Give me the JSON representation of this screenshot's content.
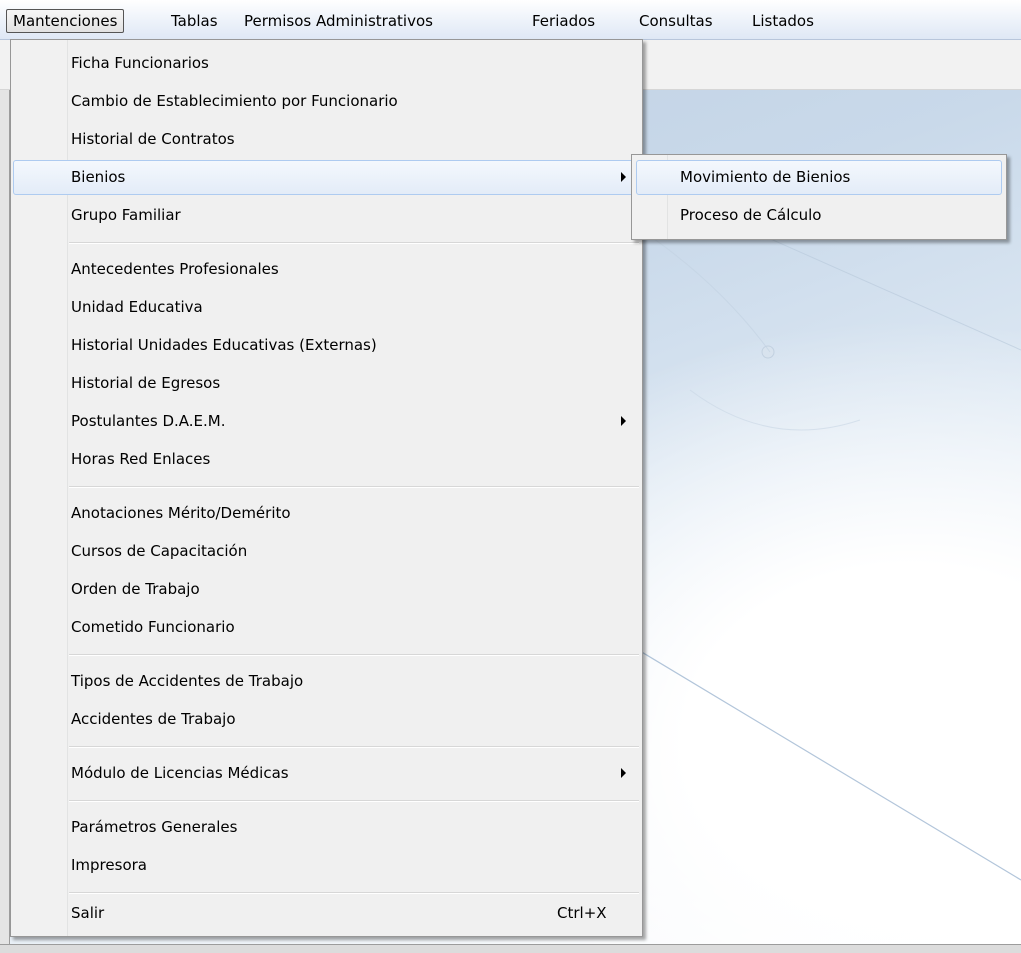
{
  "menubar": {
    "items": [
      {
        "label": "Mantenciones"
      },
      {
        "label": "Tablas"
      },
      {
        "label": "Permisos Administrativos"
      },
      {
        "label": "Feriados"
      },
      {
        "label": "Consultas"
      },
      {
        "label": "Listados"
      }
    ]
  },
  "main_menu": {
    "items": [
      {
        "label": "Ficha Funcionarios"
      },
      {
        "label": "Cambio de Establecimiento por Funcionario"
      },
      {
        "label": "Historial de Contratos"
      },
      {
        "label": "Bienios"
      },
      {
        "label": "Grupo Familiar"
      },
      {
        "label": "Antecedentes Profesionales"
      },
      {
        "label": "Unidad Educativa"
      },
      {
        "label": "Historial Unidades Educativas (Externas)"
      },
      {
        "label": "Historial de Egresos"
      },
      {
        "label": "Postulantes D.A.E.M."
      },
      {
        "label": "Horas Red Enlaces"
      },
      {
        "label": "Anotaciones Mérito/Demérito"
      },
      {
        "label": "Cursos de Capacitación"
      },
      {
        "label": "Orden de Trabajo"
      },
      {
        "label": "Cometido Funcionario"
      },
      {
        "label": "Tipos de Accidentes de Trabajo"
      },
      {
        "label": "Accidentes de Trabajo"
      },
      {
        "label": "Módulo de Licencias Médicas"
      },
      {
        "label": "Parámetros Generales"
      },
      {
        "label": "Impresora"
      },
      {
        "label": "Salir",
        "shortcut": "Ctrl+X"
      }
    ]
  },
  "submenu": {
    "items": [
      {
        "label": "Movimiento de Bienios"
      },
      {
        "label": "Proceso de Cálculo"
      }
    ]
  }
}
